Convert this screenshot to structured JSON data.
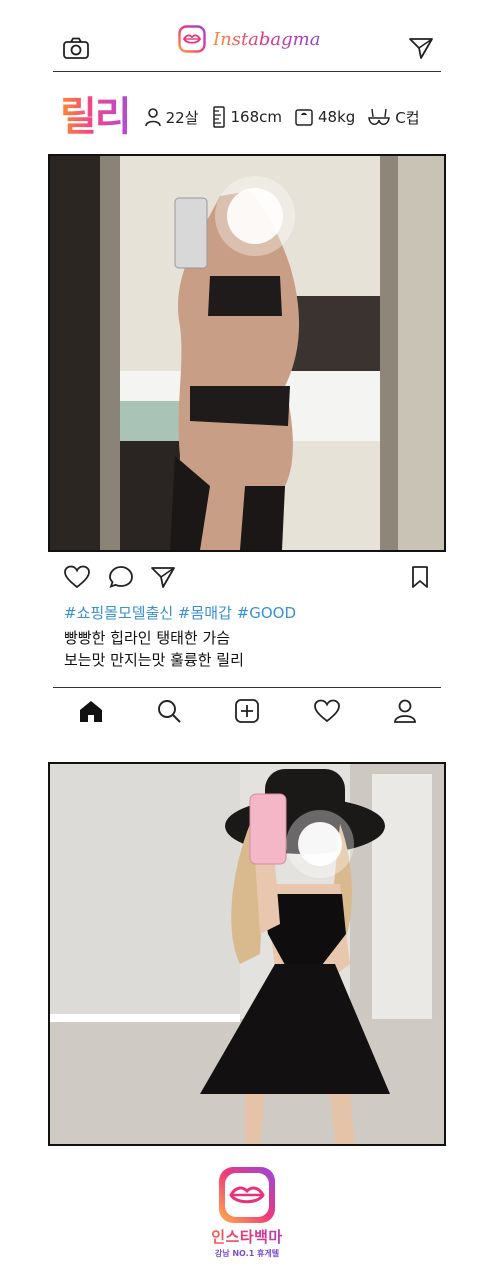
{
  "header": {
    "brand_name": "Instabagma",
    "camera_icon": "camera-icon",
    "send_icon": "send-icon"
  },
  "profile": {
    "name": "릴리",
    "age": "22살",
    "height": "168cm",
    "weight": "48kg",
    "cup": "C컵"
  },
  "post": {
    "hashtags": "#쇼핑몰모델출신 #몸매갑 #GOOD",
    "caption_line1": "빵빵한 힙라인 탱태한 가슴",
    "caption_line2": "보는맛 만지는맛 훌륭한 릴리",
    "actions": [
      "heart-icon",
      "comment-icon",
      "share-icon",
      "bookmark-icon"
    ]
  },
  "nav": [
    "home-icon",
    "search-icon",
    "add-post-icon",
    "heart-icon",
    "profile-icon"
  ],
  "footer": {
    "title": "인스타백마",
    "subtitle": "강남 NO.1 휴게텔"
  },
  "colors": {
    "brand_orange": "#ff8a2a",
    "brand_pink": "#e8337a",
    "brand_purple": "#9a45e0",
    "hashtag_blue": "#3a90d4"
  }
}
